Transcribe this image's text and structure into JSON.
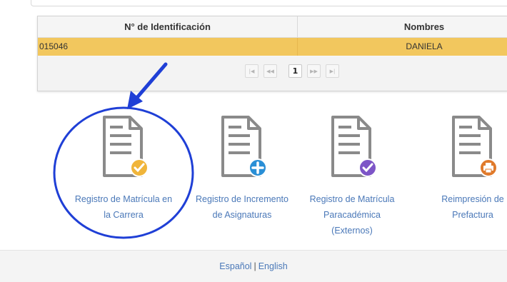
{
  "grid": {
    "columns": [
      "N° de Identificación",
      "Nombres"
    ],
    "rows": [
      {
        "id": "015046",
        "name": "DANIELA"
      }
    ],
    "pager": {
      "first_icon": "first-page-icon",
      "prev_icon": "prev-page-icon",
      "current_page": "1",
      "next_icon": "next-page-icon",
      "last_icon": "last-page-icon"
    }
  },
  "options": [
    {
      "label_line1": "Registro de Matrícula en",
      "label_line2": "la Carrera",
      "badge_icon": "check-icon",
      "badge_color": "#f0b53a"
    },
    {
      "label_line1": "Registro de Incremento",
      "label_line2": "de Asignaturas",
      "badge_icon": "plus-icon",
      "badge_color": "#2a8fd6"
    },
    {
      "label_line1": "Registro de Matrícula",
      "label_line2": "Paracadémica (Externos)",
      "badge_icon": "check-icon",
      "badge_color": "#7d55c7"
    },
    {
      "label_line1": "Reimpresión de",
      "label_line2": "Prefactura",
      "badge_icon": "printer-icon",
      "badge_color": "#e07a2b"
    }
  ],
  "footer": {
    "lang_es": "Español",
    "separator": "|",
    "lang_en": "English"
  },
  "annotation": {
    "color": "#1f3fd6"
  }
}
